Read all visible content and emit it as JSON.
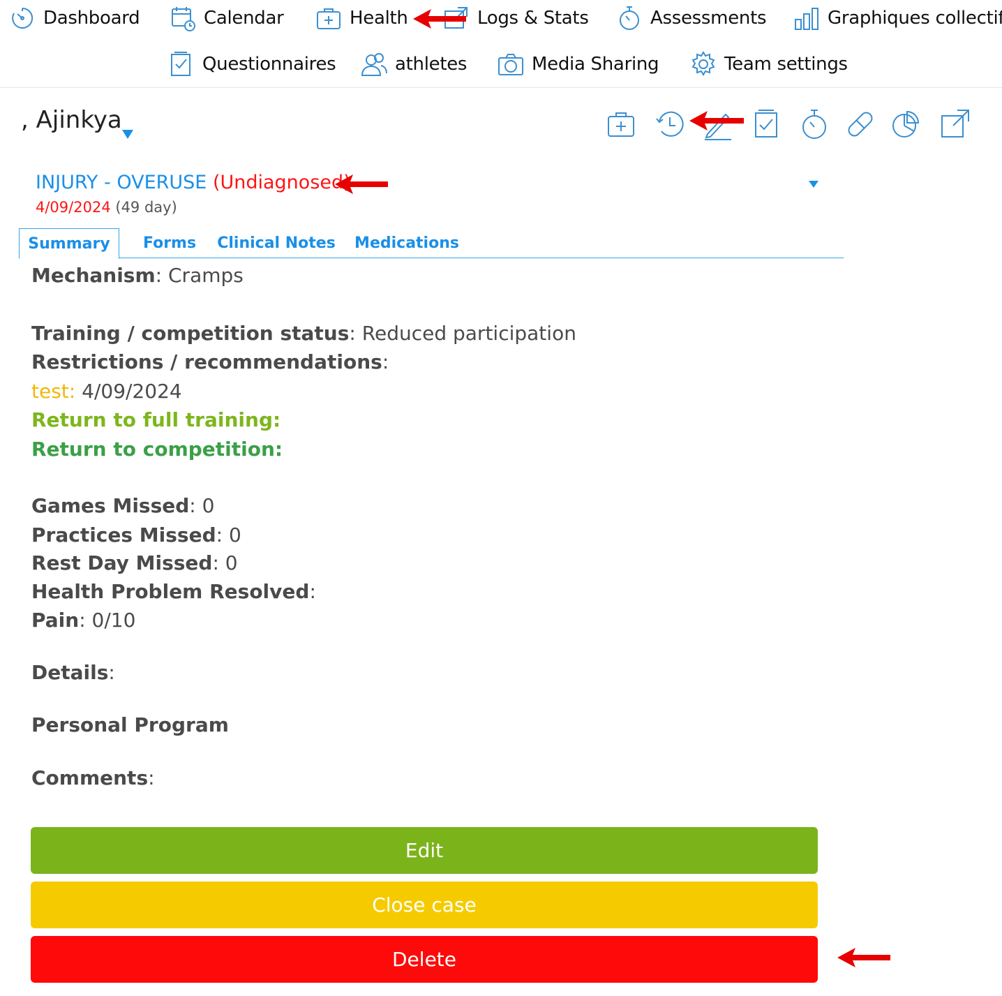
{
  "nav": {
    "items": [
      {
        "label": "Dashboard",
        "icon": "dashboard-gauge-icon"
      },
      {
        "label": "Calendar",
        "icon": "calendar-icon"
      },
      {
        "label": "Health",
        "icon": "medical-kit-icon"
      },
      {
        "label": "Logs & Stats",
        "icon": "external-link-icon"
      },
      {
        "label": "Assessments",
        "icon": "stopwatch-icon"
      },
      {
        "label": "Graphiques collectifs",
        "icon": "bar-chart-icon"
      },
      {
        "label": "Questionnaires",
        "icon": "checklist-icon"
      },
      {
        "label": "athletes",
        "icon": "users-icon"
      },
      {
        "label": "Media Sharing",
        "icon": "camera-icon"
      },
      {
        "label": "Team settings",
        "icon": "gear-icon"
      }
    ]
  },
  "athlete": {
    "name": ", Ajinkya"
  },
  "actions": [
    {
      "name": "medical-kit-icon"
    },
    {
      "name": "history-icon"
    },
    {
      "name": "edit-pen-icon"
    },
    {
      "name": "checklist-icon"
    },
    {
      "name": "stopwatch-icon"
    },
    {
      "name": "pill-icon"
    },
    {
      "name": "pie-chart-icon"
    },
    {
      "name": "external-link-icon"
    }
  ],
  "case": {
    "type": "INJURY - OVERUSE",
    "status": "(Undiagnosed)",
    "date": "4/09/2024",
    "duration": "(49 day)"
  },
  "tabs": [
    "Summary",
    "Forms",
    "Clinical Notes",
    "Medications"
  ],
  "summary": {
    "mechanism_label": "Mechanism",
    "mechanism_value": "Cramps",
    "status_label": "Training / competition status",
    "status_value": "Reduced participation",
    "restrictions_label": "Restrictions / recommendations",
    "test_label": "test",
    "test_value": "4/09/2024",
    "rtt_label": "Return to full training",
    "rtc_label": "Return to competition",
    "games_label": "Games Missed",
    "games_value": "0",
    "practices_label": "Practices Missed",
    "practices_value": "0",
    "rest_label": "Rest Day Missed",
    "rest_value": "0",
    "resolved_label": "Health Problem Resolved",
    "pain_label": "Pain",
    "pain_value": "0/10",
    "details_label": "Details",
    "program_label": "Personal Program",
    "comments_label": "Comments"
  },
  "buttons": {
    "edit": "Edit",
    "close": "Close case",
    "delete": "Delete"
  },
  "colors": {
    "accent_blue": "#1a8fe8",
    "status_red": "#ff1414",
    "edit_green": "#7bb31a",
    "close_yellow": "#f5cb00",
    "delete_red": "#ff0a0a",
    "annotation_arrow": "#e60000"
  }
}
